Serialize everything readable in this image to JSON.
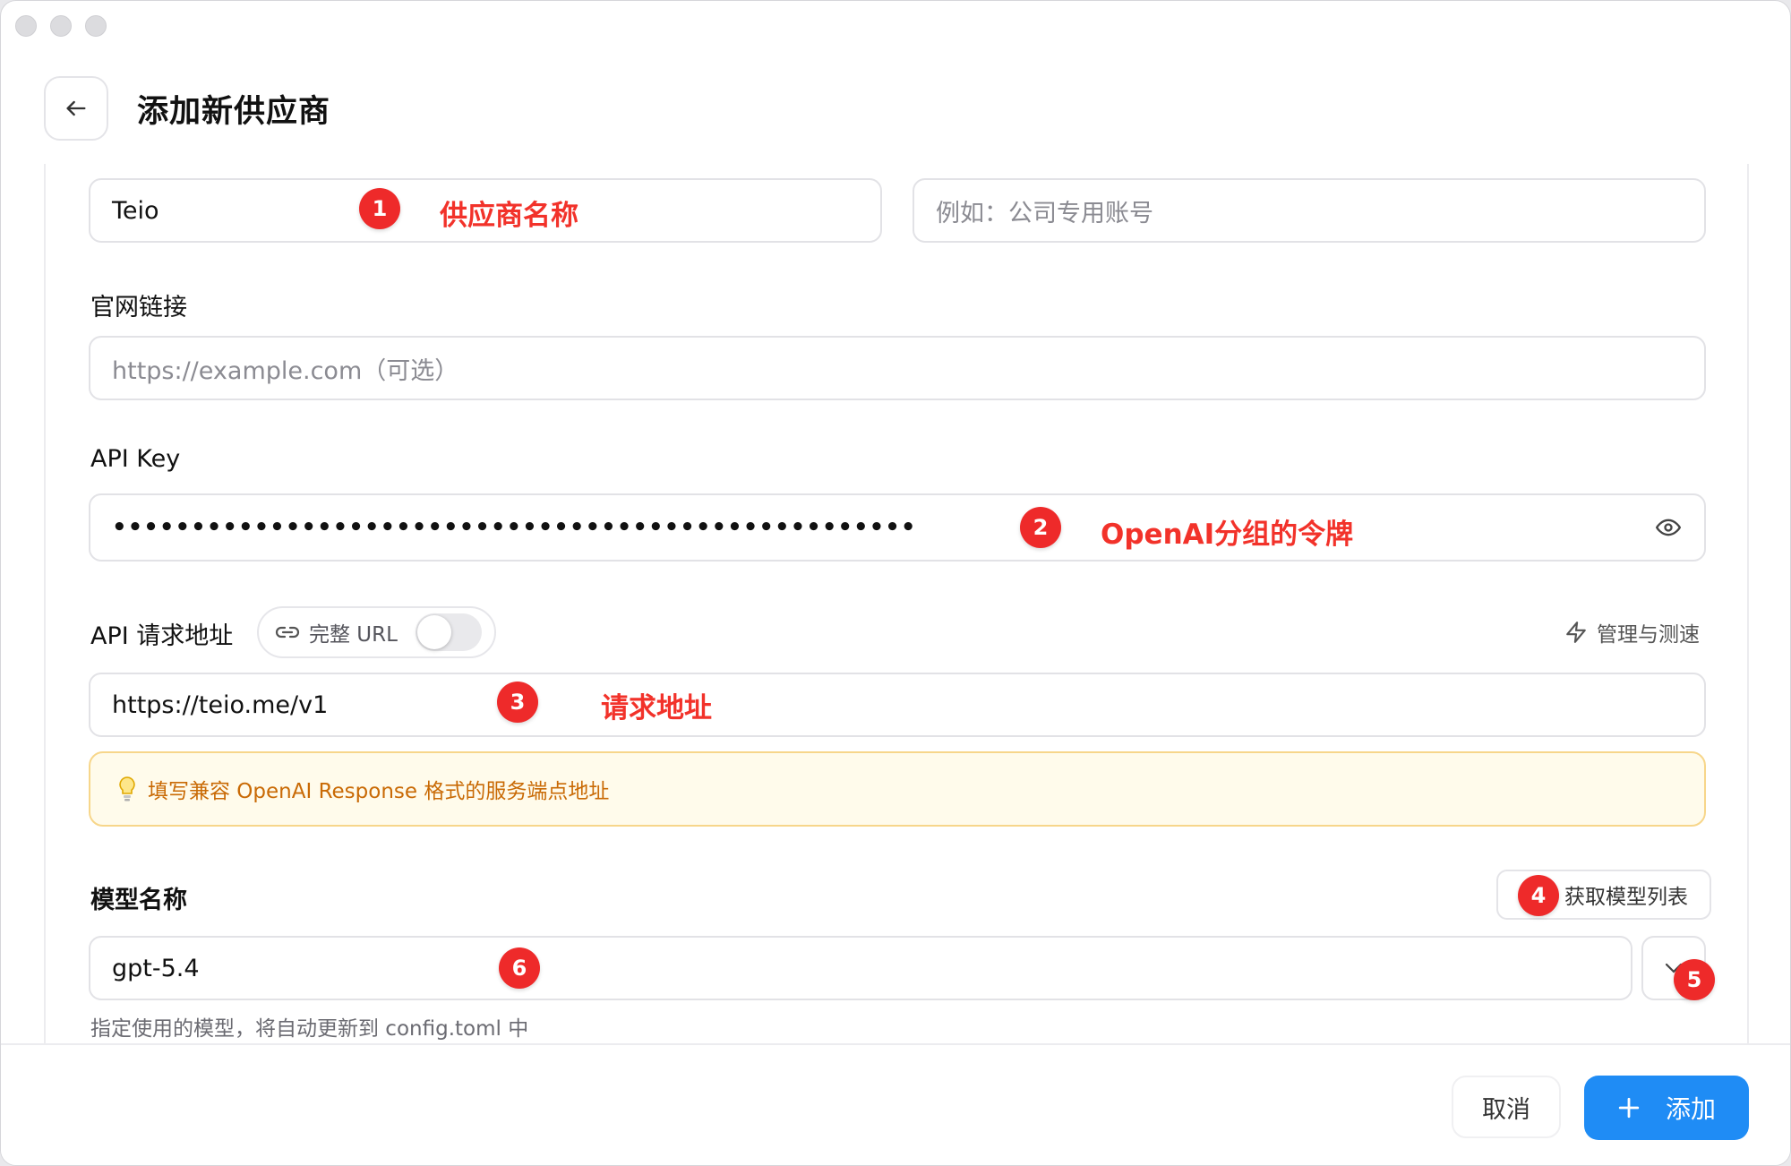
{
  "window": {
    "title": "添加新供应商"
  },
  "provider_name": {
    "value": "Teio",
    "annotation": "供应商名称",
    "badge": "1"
  },
  "remark": {
    "placeholder": "例如：公司专用账号"
  },
  "website": {
    "label": "官网链接",
    "placeholder": "https://example.com（可选）"
  },
  "api_key": {
    "label": "API Key",
    "masked_value": "•••••••••••••••••••••••••••••••••••••••••••••••••••",
    "annotation": "OpenAI分组的令牌",
    "badge": "2",
    "eye_icon": "eye-icon"
  },
  "api_endpoint": {
    "label": "API 请求地址",
    "full_url_toggle": {
      "label": "完整 URL",
      "enabled": false
    },
    "manage_link": "管理与测速",
    "value": "https://teio.me/v1",
    "annotation": "请求地址",
    "badge": "3",
    "tip": "填写兼容 OpenAI Response 格式的服务端点地址"
  },
  "model": {
    "label": "模型名称",
    "fetch_button": "获取模型列表",
    "fetch_badge": "4",
    "value": "gpt-5.4",
    "value_badge": "6",
    "dropdown_badge": "5",
    "help": "指定使用的模型，将自动更新到 config.toml 中"
  },
  "footer": {
    "cancel": "取消",
    "add": "添加"
  },
  "colors": {
    "accent": "#1f8cf5",
    "annotation": "#f2322a",
    "tip_bg": "#fffbeb",
    "tip_text": "#c96a05"
  }
}
